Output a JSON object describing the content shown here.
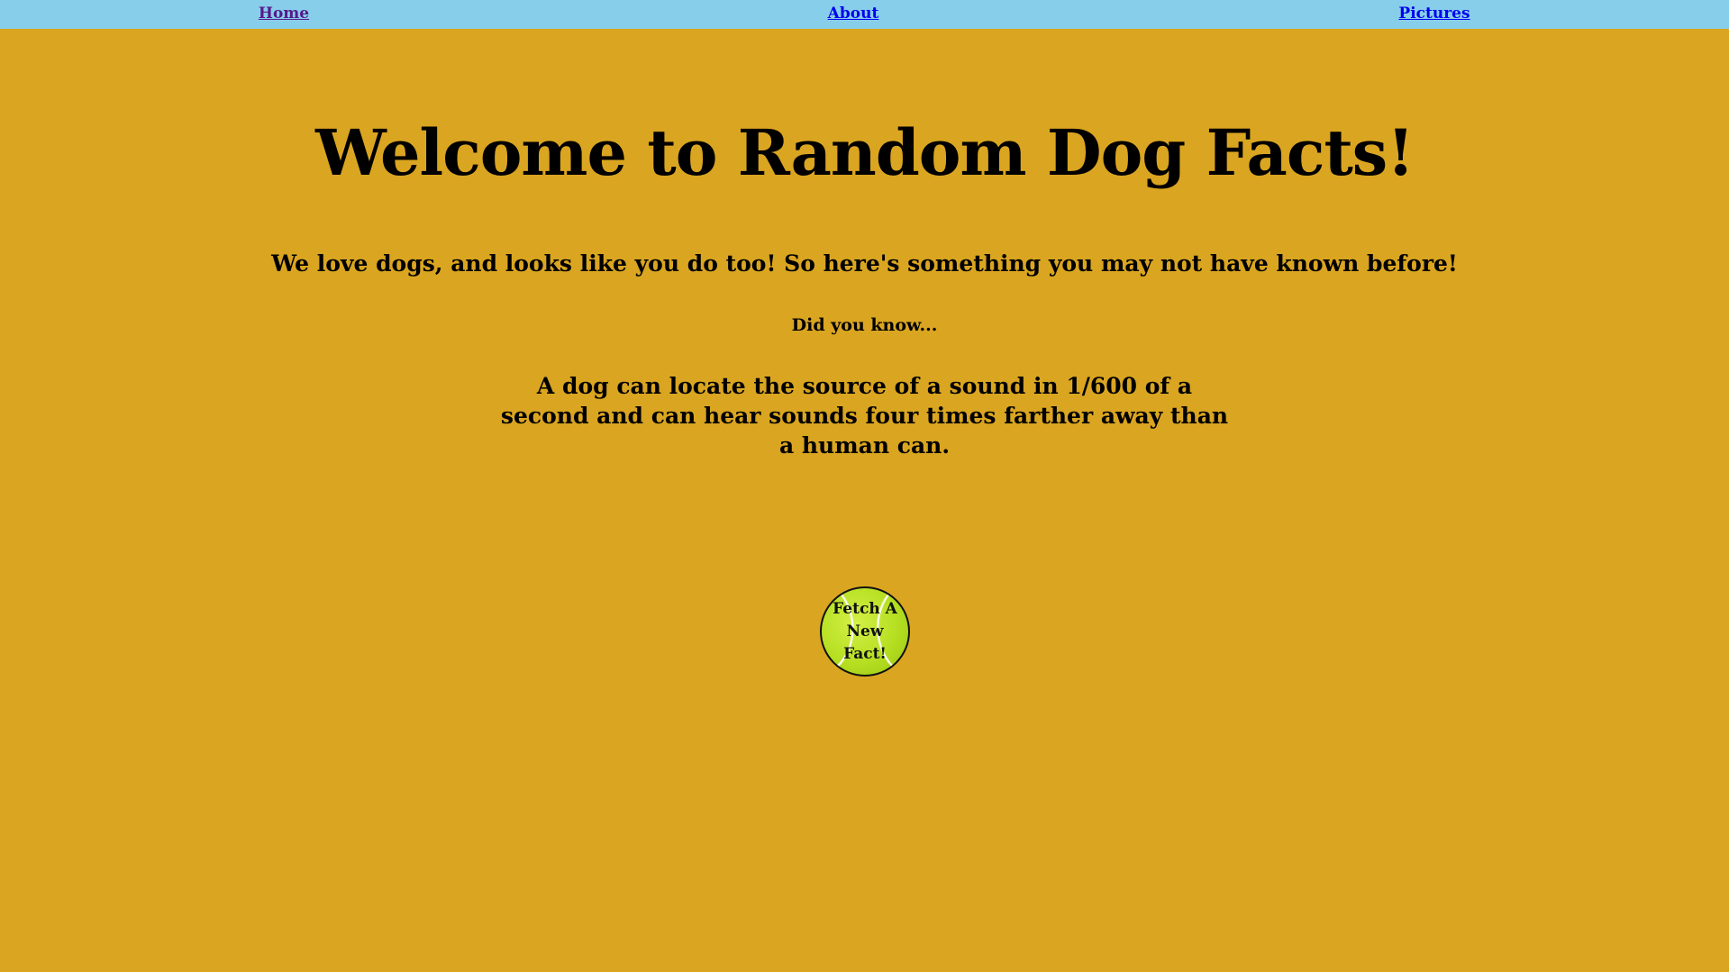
{
  "nav": {
    "home": "Home",
    "about": "About",
    "pictures": "Pictures"
  },
  "main": {
    "title": "Welcome to Random Dog Facts!",
    "intro": "We love dogs, and looks like you do too! So here's something you may not have known before!",
    "did_you_know": "Did you know...",
    "fact": "A dog can locate the source of a sound in 1/600 of a second and can hear sounds four times farther away than a human can.",
    "fetch_button_label": "Fetch A New Fact!"
  },
  "colors": {
    "page_background": "#DAA520",
    "navbar_background": "#87CEEB",
    "visited_link": "#551A8B",
    "link": "#0000EE",
    "tennis_ball": "#B6DF22"
  },
  "icons": {
    "fetch_button": "tennis-ball-icon"
  }
}
